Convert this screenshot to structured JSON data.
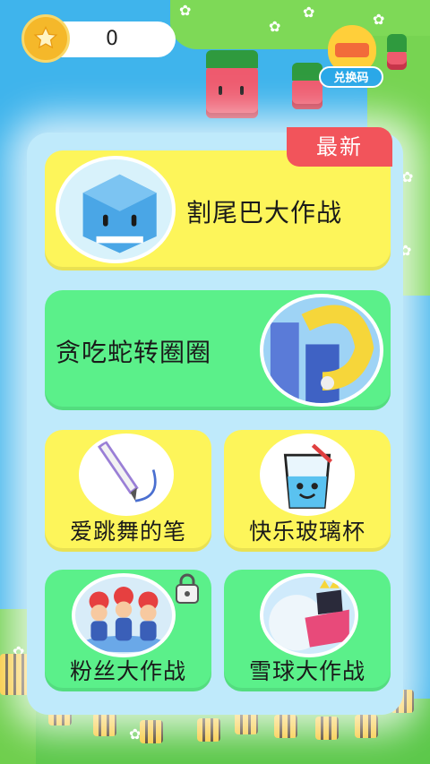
{
  "colors": {
    "sea": "#3fb4ec",
    "card_yellow": "#fdf55a",
    "card_green": "#5bf08a",
    "new_tag": "#f2545b"
  },
  "coins": {
    "count": "0",
    "icon": "star-coin-icon"
  },
  "redeem": {
    "label": "兑换码",
    "icon": "chick-icon"
  },
  "badge": {
    "new_label": "最新"
  },
  "games": [
    {
      "title": "割尾巴大作战",
      "icon": "whale-icon"
    },
    {
      "title": "贪吃蛇转圈圈",
      "icon": "snake-tower-icon"
    },
    {
      "title": "爱跳舞的笔",
      "icon": "3d-pen-icon"
    },
    {
      "title": "快乐玻璃杯",
      "icon": "glass-cup-icon"
    },
    {
      "title": "粉丝大作战",
      "icon": "fans-crowd-icon",
      "locked": true
    },
    {
      "title": "雪球大作战",
      "icon": "snowball-icon"
    }
  ],
  "lock_icon": "padlock-icon"
}
